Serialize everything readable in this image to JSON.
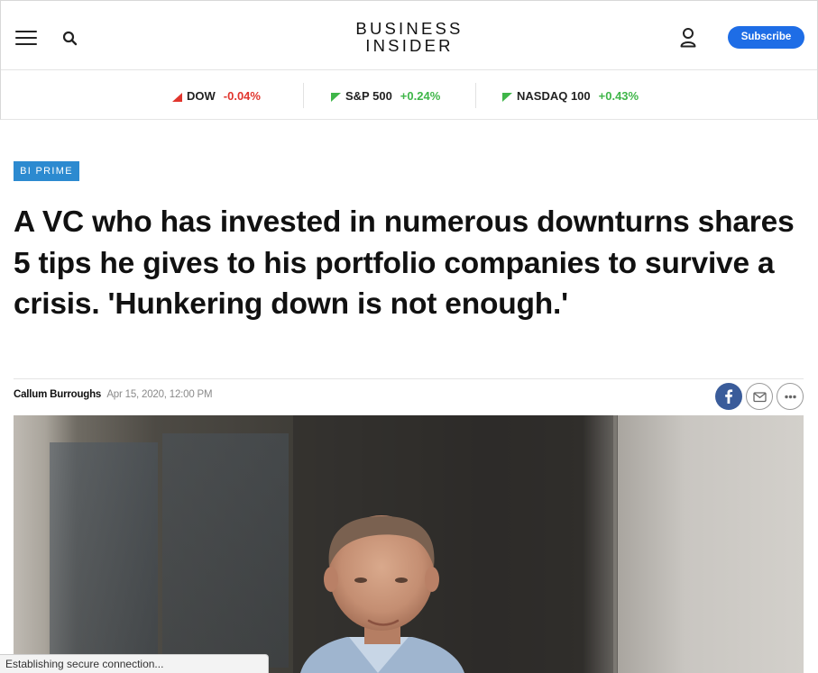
{
  "header": {
    "logo_line1": "BUSINESS",
    "logo_line2": "INSIDER",
    "subscribe_label": "Subscribe",
    "icons": [
      "menu-icon",
      "search-icon",
      "user-icon"
    ]
  },
  "ticker": [
    {
      "name": "DOW",
      "change": "-0.04%",
      "direction": "down",
      "color": "#e1352d"
    },
    {
      "name": "S&P 500",
      "change": "+0.24%",
      "direction": "up",
      "color": "#3fb649"
    },
    {
      "name": "NASDAQ 100",
      "change": "+0.43%",
      "direction": "up",
      "color": "#3fb649"
    }
  ],
  "article": {
    "badge": "BI PRIME",
    "headline": "A VC who has invested in numerous downturns shares 5 tips he gives to his portfolio companies to survive a crisis. 'Hunkering down is not enough.'",
    "author": "Callum Burroughs",
    "date": "Apr 15, 2020, 12:00 PM",
    "share_icons": [
      "facebook-icon",
      "email-icon",
      "more-icon"
    ]
  },
  "status_bar": "Establishing secure connection...",
  "colors": {
    "subscribe": "#1e6de6",
    "badge": "#2c8ad0",
    "negative": "#e1352d",
    "positive": "#3fb649",
    "facebook": "#3a5c9a"
  }
}
